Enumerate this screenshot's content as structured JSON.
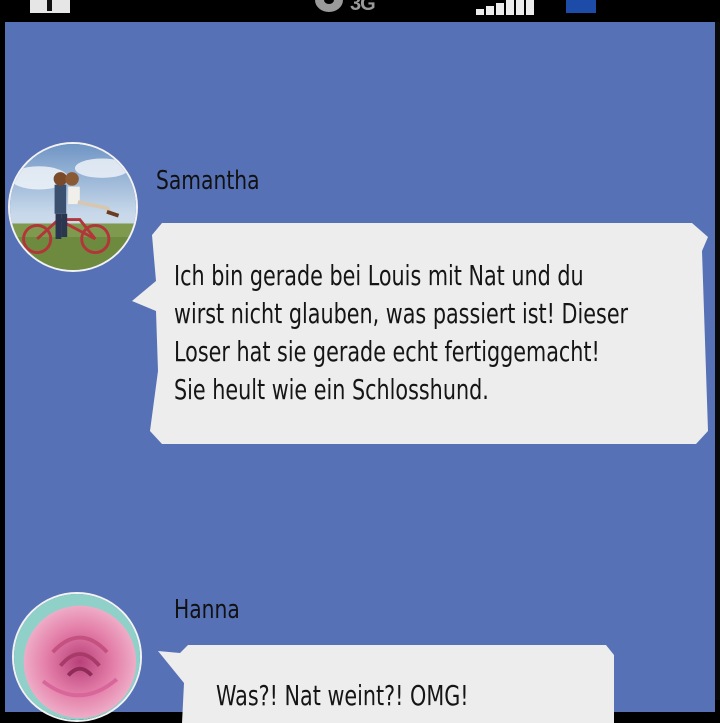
{
  "status_bar": {
    "network_label": "3G",
    "icons": [
      "notification-icon",
      "gear-icon",
      "signal-icon",
      "battery-icon"
    ]
  },
  "colors": {
    "chat_background": "#5771b7",
    "bubble": "#ededed",
    "status_bar": "#000000",
    "battery": "#1d4ba8"
  },
  "messages": [
    {
      "sender": "Samantha",
      "avatar": "couple-on-bicycle-photo",
      "lines": [
        "Ich bin gerade bei Louis mit Nat und du",
        "wirst nicht glauben, was passiert ist! Dieser",
        "Loser hat sie gerade echt fertiggemacht!",
        "Sie heult wie ein Schlosshund."
      ]
    },
    {
      "sender": "Hanna",
      "avatar": "pink-rose-photo",
      "lines": [
        "Was?! Nat weint?! OMG!"
      ]
    }
  ]
}
